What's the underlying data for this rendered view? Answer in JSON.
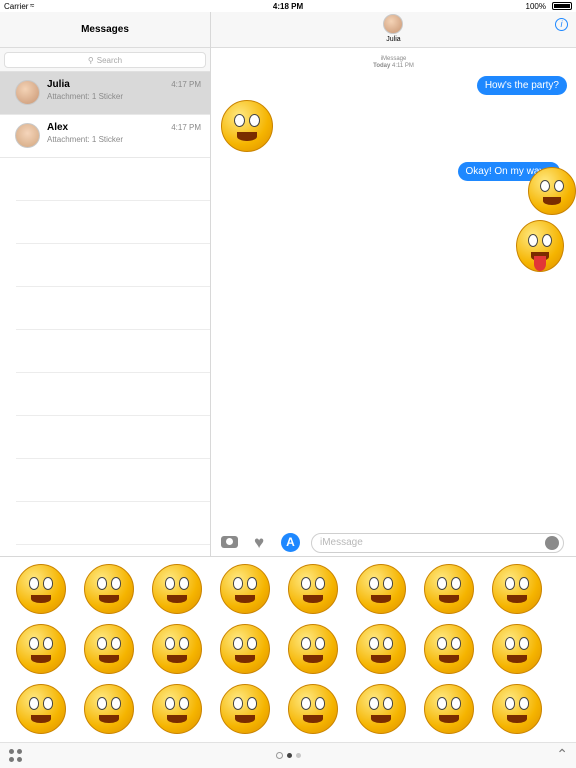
{
  "status": {
    "carrier": "Carrier",
    "time": "4:18 PM",
    "battery": "100%"
  },
  "sidebar": {
    "title": "Messages",
    "search_placeholder": "Search",
    "conversations": [
      {
        "name": "Julia",
        "preview": "Attachment: 1 Sticker",
        "time": "4:17 PM"
      },
      {
        "name": "Alex",
        "preview": "Attachment: 1 Sticker",
        "time": "4:17 PM"
      }
    ]
  },
  "chat": {
    "contact": "Julia",
    "service": "iMessage",
    "today_label": "Today",
    "time": "4:11 PM",
    "messages": [
      {
        "text": "How's the party?"
      },
      {
        "text": "Okay! On my way..."
      }
    ],
    "stickers": [
      "thumbs-up-emoji",
      "jumping-emoji",
      "tongue-out-emoji"
    ]
  },
  "composer": {
    "placeholder": "iMessage"
  },
  "stickers": [
    "tongue-wink-emoji",
    "magnifier-emoji",
    "shocked-emoji",
    "suspicious-emoji",
    "binoculars-emoji",
    "scared-emoji",
    "toilet-emoji",
    "poop-hat-emoji",
    "hat-smile-emoji",
    "pinocchio-emoji",
    "drooling-emoji",
    "vomit-emoji",
    "mustache-emoji",
    "forbidden-emoji",
    "bandaged-emoji",
    "mafia-emoji",
    "singing-emoji",
    "flower-emoji",
    "thinking-emoji",
    "grinning-emoji",
    "heart-eyes-emoji",
    "cool-sunglasses-emoji",
    "love-tongue-emoji",
    "kiss-emoji"
  ],
  "colors": {
    "accent": "#1e88ff",
    "bubble_text": "#ffffff",
    "emoji_yellow": "#f5b400"
  }
}
